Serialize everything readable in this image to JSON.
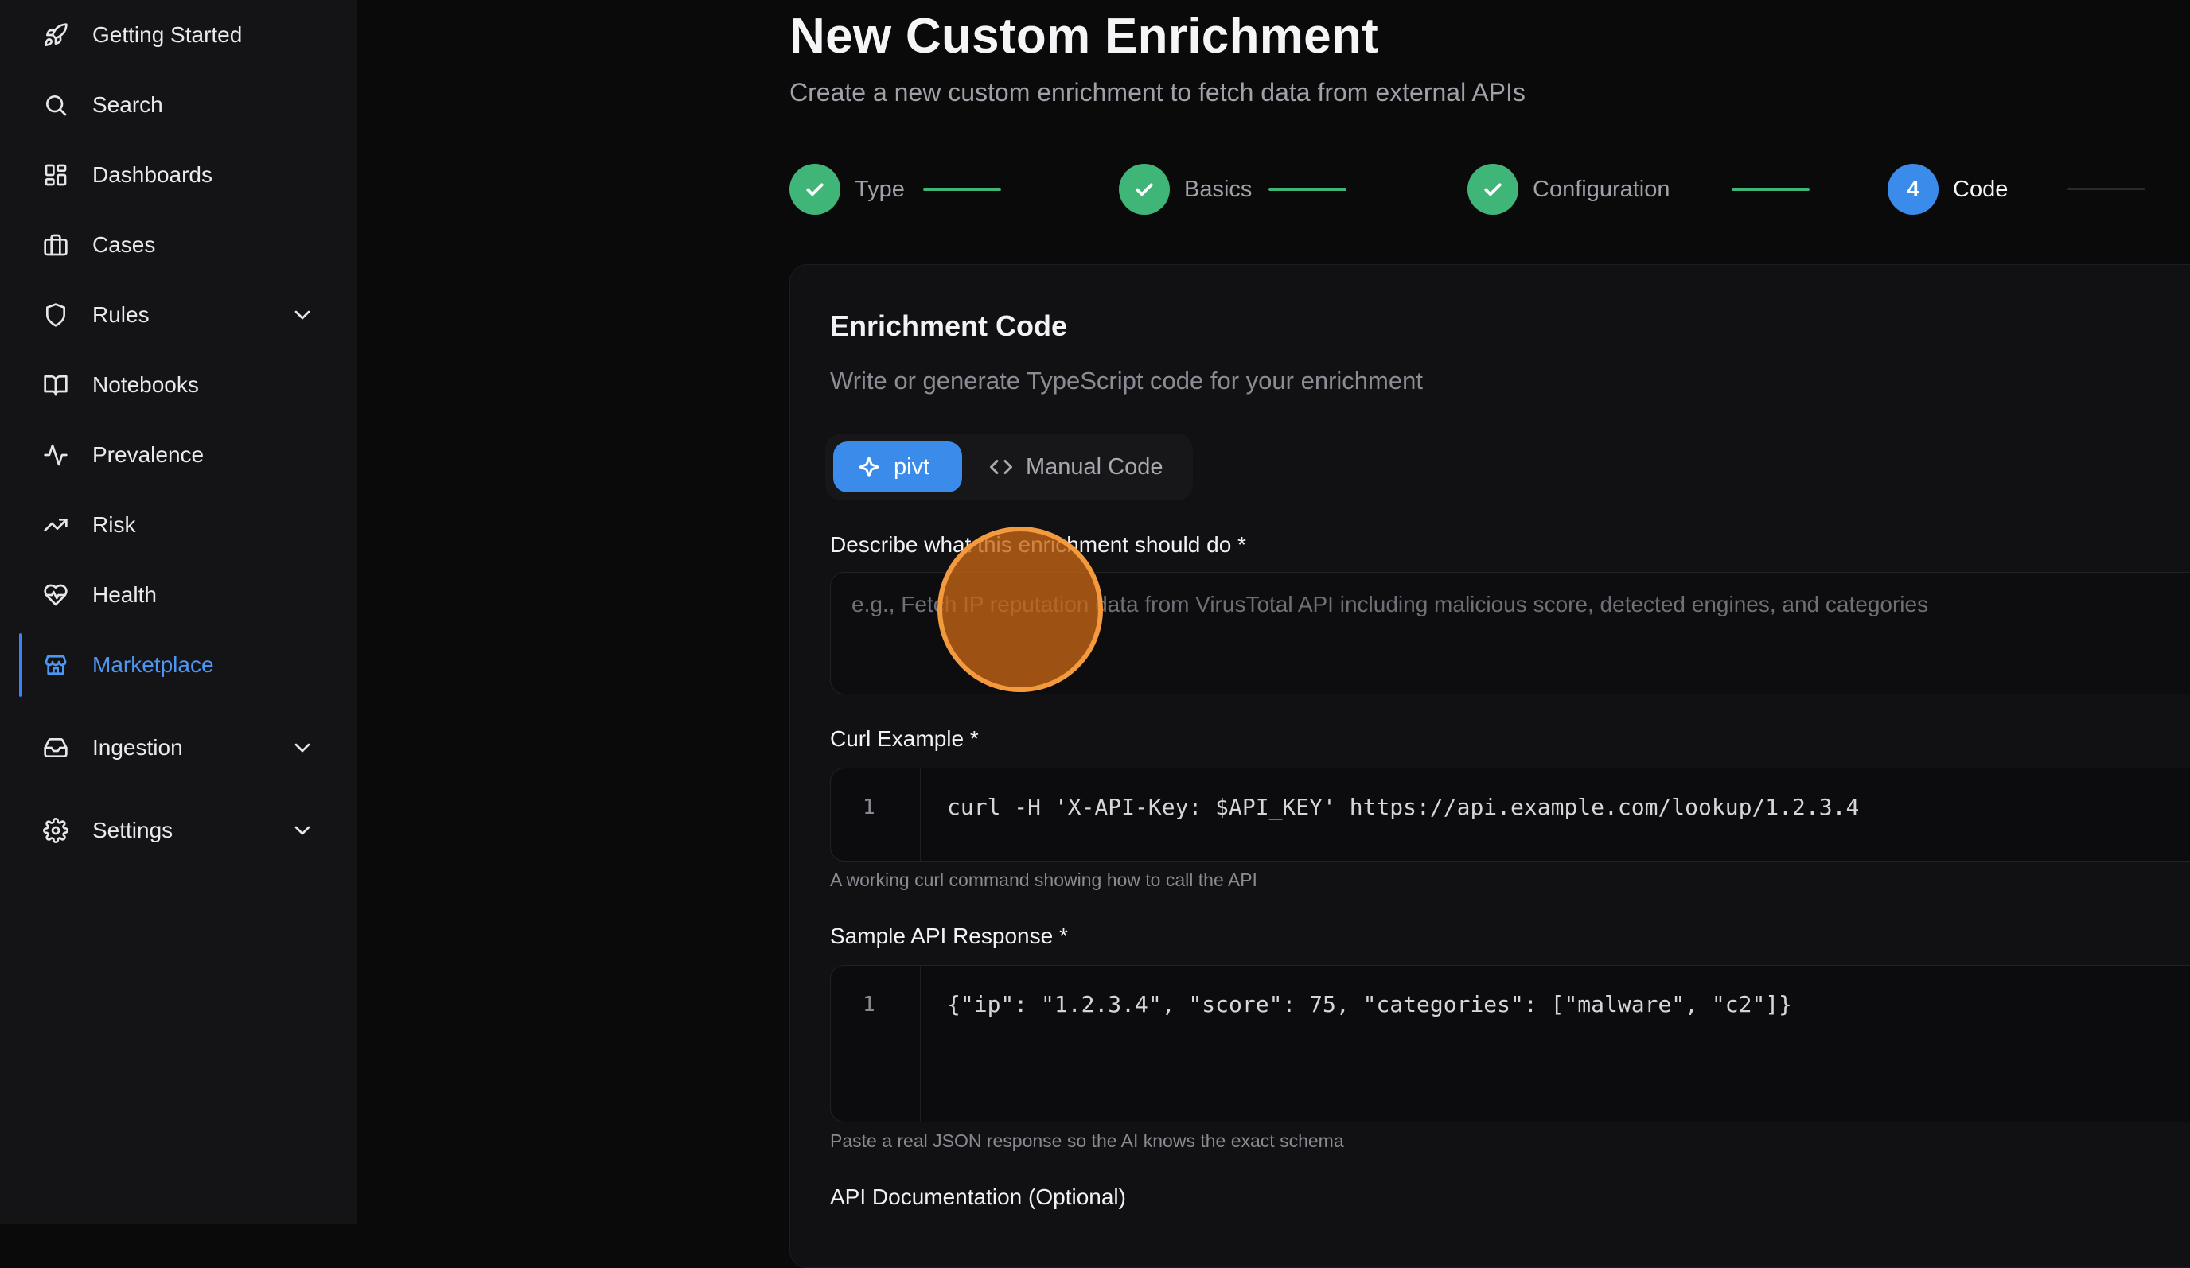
{
  "sidebar": {
    "items": [
      {
        "label": "Getting Started",
        "icon": "rocket-icon"
      },
      {
        "label": "Search",
        "icon": "search-icon"
      },
      {
        "label": "Dashboards",
        "icon": "grid-icon"
      },
      {
        "label": "Cases",
        "icon": "briefcase-icon"
      },
      {
        "label": "Rules",
        "icon": "shield-icon"
      },
      {
        "label": "Notebooks",
        "icon": "book-icon"
      },
      {
        "label": "Prevalence",
        "icon": "activity-icon"
      },
      {
        "label": "Risk",
        "icon": "trending-up-icon"
      },
      {
        "label": "Health",
        "icon": "heart-pulse-icon"
      },
      {
        "label": "Marketplace",
        "icon": "store-icon"
      },
      {
        "label": "Ingestion",
        "icon": "inbox-icon"
      },
      {
        "label": "Settings",
        "icon": "gear-icon"
      }
    ],
    "active": "Marketplace",
    "accent_color": "#4d97f2"
  },
  "page": {
    "title": "New Custom Enrichment",
    "subtitle": "Create a new custom enrichment to fetch data from external APIs"
  },
  "stepper": {
    "steps": [
      {
        "label": "Type",
        "state": "done"
      },
      {
        "label": "Basics",
        "state": "done"
      },
      {
        "label": "Configuration",
        "state": "done"
      },
      {
        "label": "Code",
        "number": "4",
        "state": "current"
      }
    ],
    "done_color": "#3fb577",
    "current_color": "#3b8beb"
  },
  "card": {
    "title": "Enrichment Code",
    "description": "Write or generate TypeScript code for your enrichment",
    "mode_toggle": {
      "ai_label": "pivt",
      "manual_label": "Manual Code",
      "selected": "pivt"
    },
    "describe": {
      "label": "Describe what this enrichment should do *",
      "placeholder": "e.g., Fetch IP reputation data from VirusTotal API including malicious score, detected engines, and categories"
    },
    "curl": {
      "label": "Curl Example *",
      "line_number": "1",
      "code": "curl -H 'X-API-Key: $API_KEY' https://api.example.com/lookup/1.2.3.4",
      "hint": "A working curl command showing how to call the API"
    },
    "sample_response": {
      "label": "Sample API Response *",
      "line_number": "1",
      "code": "{\"ip\": \"1.2.3.4\", \"score\": 75, \"categories\": [\"malware\", \"c2\"]}",
      "hint": "Paste a real JSON response so the AI knows the exact schema"
    },
    "api_docs": {
      "label": "API Documentation (Optional)"
    }
  }
}
